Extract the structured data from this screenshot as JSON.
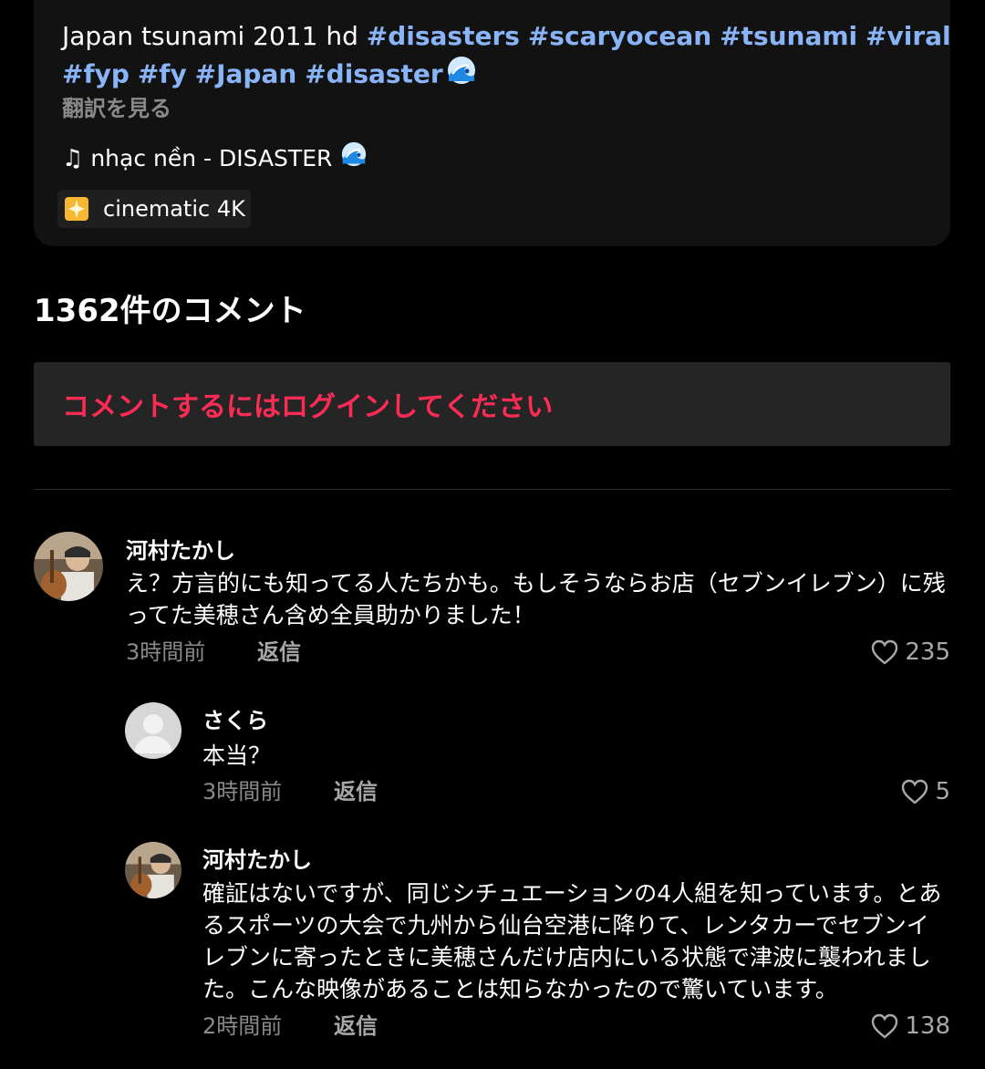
{
  "description": {
    "line1_text": "Japan tsunami 2011 hd ",
    "line1_tags": [
      "#disasters",
      "#scaryocean",
      "#tsunami",
      "#viral"
    ],
    "line2_tags": [
      "#fyp",
      "#fy",
      "#Japan",
      "#disaster"
    ],
    "wave_icon": "wave-icon",
    "translate_label": "翻訳を見る",
    "music_label": "nhạc nền - DISASTER",
    "music_icon": "music-note-icon",
    "effect_label": "cinematic 4K",
    "effect_icon": "sparkle-icon"
  },
  "comments_header": {
    "count_label": "1362件のコメント"
  },
  "login_prompt": {
    "label": "コメントするにはログインしてください"
  },
  "comments": [
    {
      "username": "河村たかし",
      "text": "え？方言的にも知ってる人たちかも。もしそうならお店（セブンイレブン）に残ってた美穂さん含め全員助かりました！",
      "time": "3時間前",
      "reply_label": "返信",
      "likes": "235"
    },
    {
      "username": "さくら",
      "text": "本当？",
      "time": "3時間前",
      "reply_label": "返信",
      "likes": "5"
    },
    {
      "username": "河村たかし",
      "text": "確証はないですが、同じシチュエーションの4人組を知っています。とあるスポーツの大会で九州から仙台空港に降りて、レンタカーでセブンイレブンに寄ったときに美穂さんだけ店内にいる状態で津波に襲われました。こんな映像があることは知らなかったので驚いています。",
      "time": "2時間前",
      "reply_label": "返信",
      "likes": "138"
    }
  ],
  "colors": {
    "hashtag": "#8ab4f8",
    "login_prompt": "#fe2c55",
    "background": "#000000",
    "card": "#121212"
  }
}
